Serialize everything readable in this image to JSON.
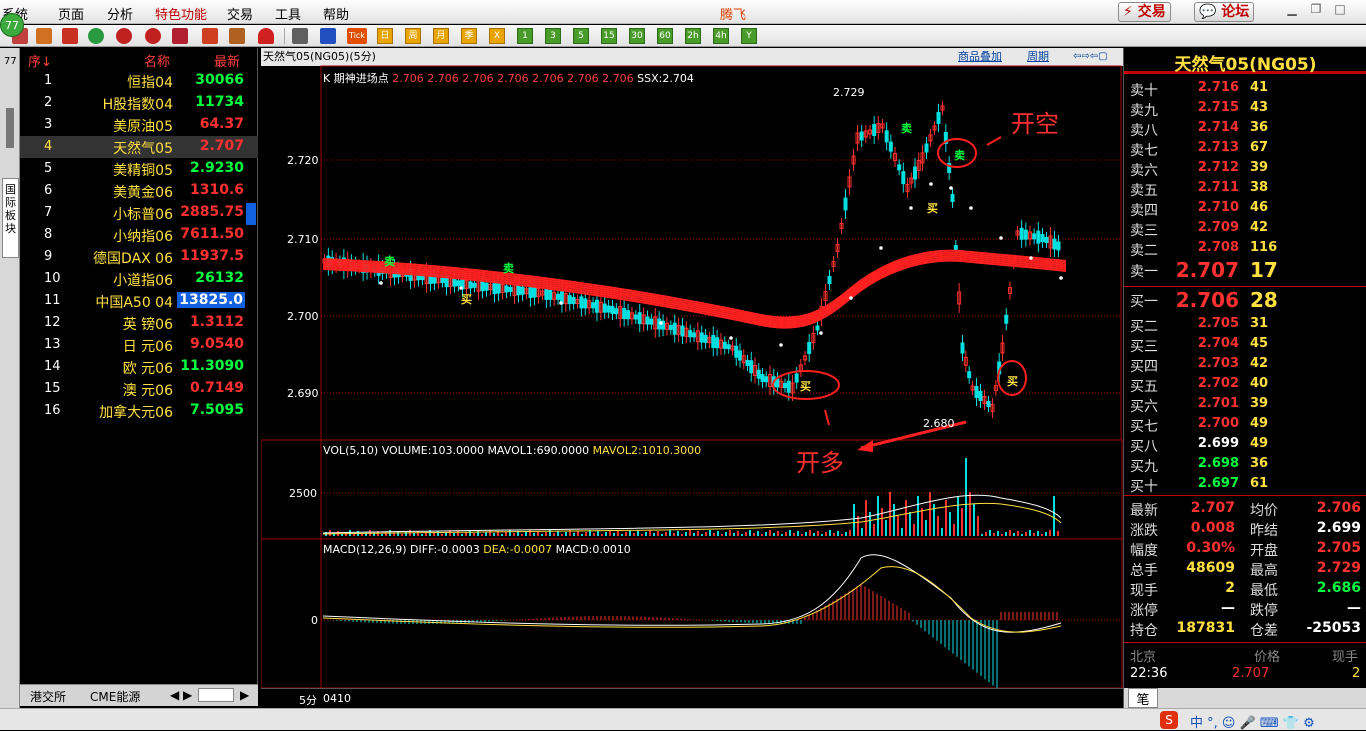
{
  "app": {
    "title": "腾飞",
    "badge": "77",
    "vtab_label": "国际板块"
  },
  "menu": {
    "items": [
      "系统",
      "页面",
      "分析",
      "特色功能",
      "交易",
      "工具",
      "帮助"
    ]
  },
  "top_buttons": {
    "trade": "⚡ 交易",
    "forum": "💬 论坛"
  },
  "toolbar": {
    "num_buttons": [
      "日",
      "周",
      "月",
      "季",
      "X",
      "1",
      "3",
      "5",
      "15",
      "30",
      "60",
      "2h",
      "4h",
      "Y"
    ],
    "tick_label": "Tick"
  },
  "list": {
    "header": {
      "seq": "序↓",
      "name": "名称",
      "latest": "最新"
    },
    "rows": [
      {
        "n": "1",
        "name": "恒指04",
        "price": "30066",
        "color": "#00ff40"
      },
      {
        "n": "2",
        "name": "H股指数04",
        "price": "11734",
        "color": "#00ff40"
      },
      {
        "n": "3",
        "name": "美原油05",
        "price": "64.37",
        "color": "#ff3030"
      },
      {
        "n": "4",
        "name": "天然气05",
        "price": "2.707",
        "color": "#ff3030"
      },
      {
        "n": "5",
        "name": "美精铜05",
        "price": "2.9230",
        "color": "#00ff40"
      },
      {
        "n": "6",
        "name": "美黄金06",
        "price": "1310.6",
        "color": "#ff3030"
      },
      {
        "n": "7",
        "name": "小标普06",
        "price": "2885.75",
        "color": "#ff3030"
      },
      {
        "n": "8",
        "name": "小纳指06",
        "price": "7611.50",
        "color": "#ff3030"
      },
      {
        "n": "9",
        "name": "德国DAX 06",
        "price": "11937.5",
        "color": "#ff3030"
      },
      {
        "n": "10",
        "name": "小道指06",
        "price": "26132",
        "color": "#00ff40"
      },
      {
        "n": "11",
        "name": "中国A50 04",
        "price": "13825.0",
        "color": "#ffffff"
      },
      {
        "n": "12",
        "name": "英 镑06",
        "price": "1.3112",
        "color": "#ff3030"
      },
      {
        "n": "13",
        "name": "日 元06",
        "price": "9.0540",
        "color": "#ff3030"
      },
      {
        "n": "14",
        "name": "欧 元06",
        "price": "11.3090",
        "color": "#00ff40"
      },
      {
        "n": "15",
        "name": "澳 元06",
        "price": "0.7149",
        "color": "#ff3030"
      },
      {
        "n": "16",
        "name": "加拿大元06",
        "price": "7.5095",
        "color": "#00ff40"
      }
    ],
    "bottom_tabs": [
      "港交所",
      "CME能源"
    ]
  },
  "chart": {
    "symbol_title": "天然气05(NG05)(5分)",
    "top_links": [
      "商品叠加",
      "周期"
    ],
    "k_info": {
      "label": "K 期神进场点",
      "values": "2.706 2.706 2.706 2.706 2.706 2.706 2.706",
      "ssx": "SSX:2.704"
    },
    "vol_info": {
      "label": "VOL(5,10) VOLUME:103.0000 MAVOL1:690.0000",
      "mavol2": "MAVOL2:1010.3000"
    },
    "macd_info": {
      "label": "MACD(12,26,9) DIFF:-0.0003",
      "dea": "DEA:-0.0007",
      "macd": "MACD:0.0010"
    },
    "y_ticks": [
      "2.720",
      "2.710",
      "2.700",
      "2.690"
    ],
    "vol_tick": "2500",
    "macd_tick": "0",
    "high_label": "2.729",
    "low_label": "2.680",
    "signals": {
      "buy": "买",
      "sell": "卖"
    },
    "annotations": {
      "open_short": "开空",
      "open_long": "开多"
    },
    "period_label": "5分",
    "date_label": "0410"
  },
  "quote": {
    "title": "天然气05(NG05)",
    "asks": [
      {
        "l": "卖十",
        "p": "2.716",
        "v": "41"
      },
      {
        "l": "卖九",
        "p": "2.715",
        "v": "43"
      },
      {
        "l": "卖八",
        "p": "2.714",
        "v": "36"
      },
      {
        "l": "卖七",
        "p": "2.713",
        "v": "67"
      },
      {
        "l": "卖六",
        "p": "2.712",
        "v": "39"
      },
      {
        "l": "卖五",
        "p": "2.711",
        "v": "38"
      },
      {
        "l": "卖四",
        "p": "2.710",
        "v": "46"
      },
      {
        "l": "卖三",
        "p": "2.709",
        "v": "42"
      },
      {
        "l": "卖二",
        "p": "2.708",
        "v": "116"
      },
      {
        "l": "卖一",
        "p": "2.707",
        "v": "17"
      }
    ],
    "bids": [
      {
        "l": "买一",
        "p": "2.706",
        "v": "28"
      },
      {
        "l": "买二",
        "p": "2.705",
        "v": "31"
      },
      {
        "l": "买三",
        "p": "2.704",
        "v": "45"
      },
      {
        "l": "买四",
        "p": "2.703",
        "v": "42"
      },
      {
        "l": "买五",
        "p": "2.702",
        "v": "40"
      },
      {
        "l": "买六",
        "p": "2.701",
        "v": "39"
      },
      {
        "l": "买七",
        "p": "2.700",
        "v": "49"
      },
      {
        "l": "买八",
        "p": "2.699",
        "v": "49"
      },
      {
        "l": "买九",
        "p": "2.698",
        "v": "36"
      },
      {
        "l": "买十",
        "p": "2.697",
        "v": "61"
      }
    ],
    "stats": [
      {
        "a": "最新",
        "av": "2.707",
        "ac": "#ff3030",
        "b": "均价",
        "bv": "2.706",
        "bc": "#ff3030"
      },
      {
        "a": "涨跌",
        "av": "0.008",
        "ac": "#ff3030",
        "b": "昨结",
        "bv": "2.699",
        "bc": "#ffffff"
      },
      {
        "a": "幅度",
        "av": "0.30%",
        "ac": "#ff3030",
        "b": "开盘",
        "bv": "2.705",
        "bc": "#ff3030"
      },
      {
        "a": "总手",
        "av": "48609",
        "ac": "#ffe040",
        "b": "最高",
        "bv": "2.729",
        "bc": "#ff3030"
      },
      {
        "a": "现手",
        "av": "2",
        "ac": "#ffe040",
        "b": "最低",
        "bv": "2.686",
        "bc": "#00ff40"
      },
      {
        "a": "涨停",
        "av": "—",
        "ac": "#ffffff",
        "b": "跌停",
        "bv": "—",
        "bc": "#ffffff"
      },
      {
        "a": "持仓",
        "av": "187831",
        "ac": "#ffe040",
        "b": "仓差",
        "bv": "-25053",
        "bc": "#ffffff"
      }
    ],
    "tick_header": {
      "place": "北京",
      "price": "价格",
      "vol": "现手"
    },
    "tick_row": {
      "time": "22:36",
      "price": "2.707",
      "vol": "2"
    },
    "bottom_tab": "笔"
  },
  "colors": {
    "up": "#ff3030",
    "down": "#00e0e0",
    "ma": "#ff2020",
    "accent": "#c00000"
  }
}
